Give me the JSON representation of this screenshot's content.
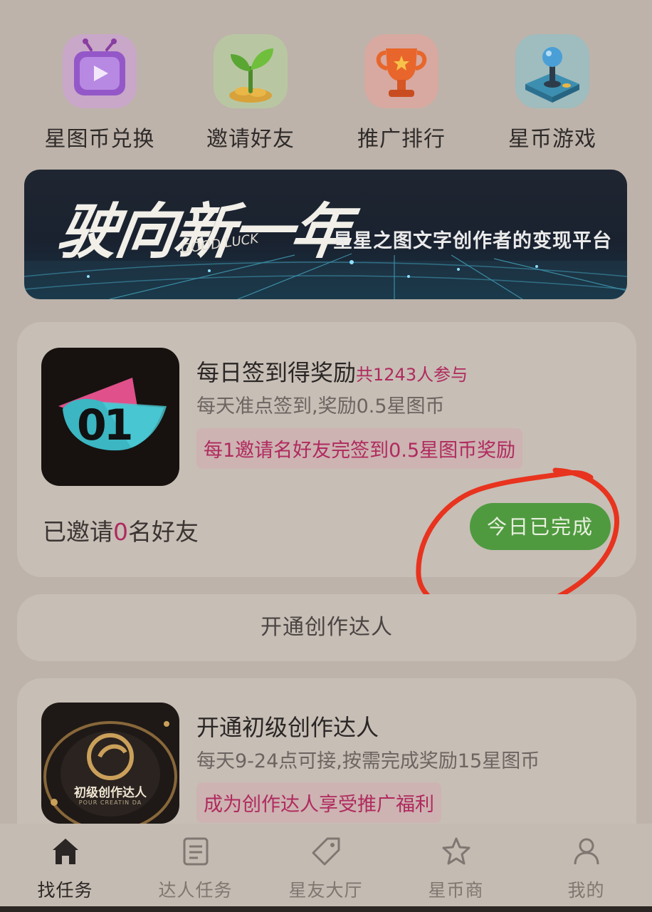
{
  "quick_actions": [
    {
      "label": "星图币兑换",
      "icon": "tv-icon"
    },
    {
      "label": "邀请好友",
      "icon": "sprout-icon"
    },
    {
      "label": "推广排行",
      "icon": "trophy-icon"
    },
    {
      "label": "星币游戏",
      "icon": "joystick-icon"
    }
  ],
  "banner": {
    "title": "驶向新一年",
    "goodluck": "GOOD LUCK",
    "slogan": "星星之图文字创作者的变现平台"
  },
  "checkin_card": {
    "title": "每日签到得奖励",
    "participants": "共1243人参与",
    "subtitle": "每天准点签到,奖励0.5星图币",
    "tag": "每1邀请名好友完签到0.5星图币奖励",
    "invited_prefix": "已邀请",
    "invited_count": "0",
    "invited_suffix": "名好友",
    "button_label": "今日已完成",
    "thumb_text": "01"
  },
  "open_creator": {
    "label": "开通创作达人"
  },
  "creator_card": {
    "title": "开通初级创作达人",
    "subtitle": "每天9-24点可接,按需完成奖励15星图币",
    "tag": "成为创作达人享受推广福利",
    "badge_text": "初级创作达人",
    "badge_sub": "POUR CREATIN DA"
  },
  "tabbar": [
    {
      "label": "找任务",
      "icon": "home-icon",
      "active": true
    },
    {
      "label": "达人任务",
      "icon": "task-list-icon",
      "active": false
    },
    {
      "label": "星友大厅",
      "icon": "tag-icon",
      "active": false
    },
    {
      "label": "星币商",
      "icon": "star-icon",
      "active": false
    },
    {
      "label": "我的",
      "icon": "user-icon",
      "active": false
    }
  ],
  "colors": {
    "accent_pink": "#b02a5e",
    "done_green": "#4f9a3f",
    "annotation_red": "#e8331e"
  }
}
